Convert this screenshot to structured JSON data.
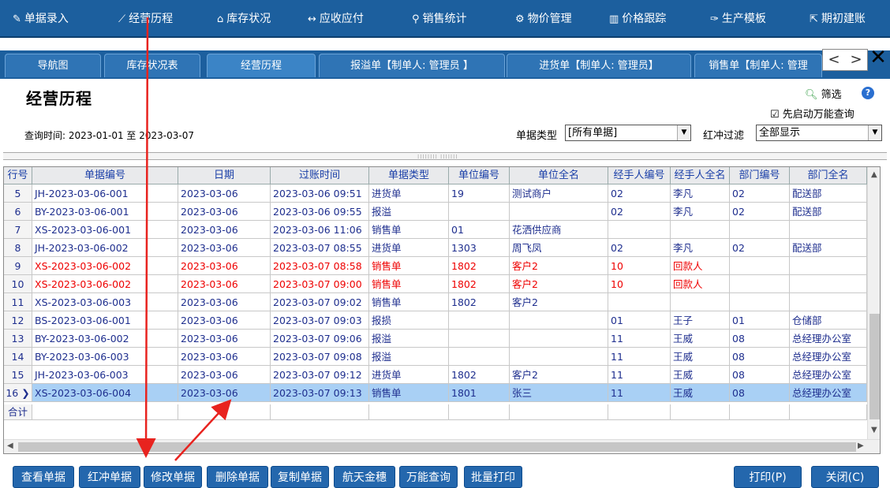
{
  "menu": [
    {
      "label": "单据录入",
      "icon": "edit-icon",
      "glyph": "✎"
    },
    {
      "label": "经营历程",
      "icon": "trend-icon",
      "glyph": "⟋"
    },
    {
      "label": "库存状况",
      "icon": "home-icon",
      "glyph": "⌂"
    },
    {
      "label": "应收应付",
      "icon": "exchange-icon",
      "glyph": "↔"
    },
    {
      "label": "销售统计",
      "icon": "search-icon",
      "glyph": "⚲"
    },
    {
      "label": "物价管理",
      "icon": "gear-icon",
      "glyph": "⚙"
    },
    {
      "label": "价格跟踪",
      "icon": "bar-chart-icon",
      "glyph": "▥"
    },
    {
      "label": "生产模板",
      "icon": "wrench-icon",
      "glyph": "✑"
    },
    {
      "label": "期初建账",
      "icon": "external-icon",
      "glyph": "⇱"
    }
  ],
  "tabs": [
    {
      "label": "导航图"
    },
    {
      "label": "库存状况表"
    },
    {
      "label": "经营历程"
    },
    {
      "label": "报溢单【制单人: 管理员 】"
    },
    {
      "label": "进货单【制单人: 管理员】"
    },
    {
      "label": "销售单【制单人: 管理"
    }
  ],
  "tabnav": {
    "prev": "<",
    "next": ">",
    "close": "✕"
  },
  "page": {
    "title": "经营历程",
    "filter_label": "筛选",
    "help_label": "?",
    "magic_query_check": "☑",
    "magic_query_label": "先启动万能查询",
    "query_time": "查询时间: 2023-01-01 至 2023-03-07",
    "doc_type_label": "单据类型",
    "doc_type_value": "[所有单据]",
    "red_filter_label": "红冲过滤",
    "red_filter_value": "全部显示",
    "splitter_grip": "⁞⁞⁞⁞⁞⁞⁞⁞ ⁞⁞⁞⁞⁞⁞⁞"
  },
  "grid": {
    "headers": [
      "行号",
      "单据编号",
      "日期",
      "过账时间",
      "单据类型",
      "单位编号",
      "单位全名",
      "经手人编号",
      "经手人全名",
      "部门编号",
      "部门全名"
    ],
    "rows": [
      {
        "no": "5",
        "c": [
          "JH-2023-03-06-001",
          "2023-03-06",
          "2023-03-06 09:51",
          "进货单",
          "19",
          "测试商户",
          "02",
          "李凡",
          "02",
          "配送部"
        ],
        "red": false,
        "sel": false
      },
      {
        "no": "6",
        "c": [
          "BY-2023-03-06-001",
          "2023-03-06",
          "2023-03-06 09:55",
          "报溢",
          "",
          "",
          "02",
          "李凡",
          "02",
          "配送部"
        ],
        "red": false,
        "sel": false
      },
      {
        "no": "7",
        "c": [
          "XS-2023-03-06-001",
          "2023-03-06",
          "2023-03-06 11:06",
          "销售单",
          "01",
          "花洒供应商",
          "",
          "",
          "",
          ""
        ],
        "red": false,
        "sel": false
      },
      {
        "no": "8",
        "c": [
          "JH-2023-03-06-002",
          "2023-03-06",
          "2023-03-07 08:55",
          "进货单",
          "1303",
          "周飞凤",
          "02",
          "李凡",
          "02",
          "配送部"
        ],
        "red": false,
        "sel": false
      },
      {
        "no": "9",
        "c": [
          "XS-2023-03-06-002",
          "2023-03-06",
          "2023-03-07 08:58",
          "销售单",
          "1802",
          "客户2",
          "10",
          "回款人",
          "",
          ""
        ],
        "red": true,
        "sel": false
      },
      {
        "no": "10",
        "c": [
          "XS-2023-03-06-002",
          "2023-03-06",
          "2023-03-07 09:00",
          "销售单",
          "1802",
          "客户2",
          "10",
          "回款人",
          "",
          ""
        ],
        "red": true,
        "sel": false
      },
      {
        "no": "11",
        "c": [
          "XS-2023-03-06-003",
          "2023-03-06",
          "2023-03-07 09:02",
          "销售单",
          "1802",
          "客户2",
          "",
          "",
          "",
          ""
        ],
        "red": false,
        "sel": false
      },
      {
        "no": "12",
        "c": [
          "BS-2023-03-06-001",
          "2023-03-06",
          "2023-03-07 09:03",
          "报损",
          "",
          "",
          "01",
          "王子",
          "01",
          "仓储部"
        ],
        "red": false,
        "sel": false
      },
      {
        "no": "13",
        "c": [
          "BY-2023-03-06-002",
          "2023-03-06",
          "2023-03-07 09:06",
          "报溢",
          "",
          "",
          "11",
          "王威",
          "08",
          "总经理办公室"
        ],
        "red": false,
        "sel": false
      },
      {
        "no": "14",
        "c": [
          "BY-2023-03-06-003",
          "2023-03-06",
          "2023-03-07 09:08",
          "报溢",
          "",
          "",
          "11",
          "王威",
          "08",
          "总经理办公室"
        ],
        "red": false,
        "sel": false
      },
      {
        "no": "15",
        "c": [
          "JH-2023-03-06-003",
          "2023-03-06",
          "2023-03-07 09:12",
          "进货单",
          "1802",
          "客户2",
          "11",
          "王威",
          "08",
          "总经理办公室"
        ],
        "red": false,
        "sel": false
      },
      {
        "no": "16 ❯",
        "c": [
          "XS-2023-03-06-004",
          "2023-03-06",
          "2023-03-07 09:13",
          "销售单",
          "1801",
          "张三",
          "11",
          "王威",
          "08",
          "总经理办公室"
        ],
        "red": false,
        "sel": true
      }
    ],
    "total_label": "合计"
  },
  "buttons": [
    {
      "label": "查看单据",
      "name": "view-doc-button"
    },
    {
      "label": "红冲单据",
      "name": "reverse-doc-button"
    },
    {
      "label": "修改单据",
      "name": "edit-doc-button"
    },
    {
      "label": "删除单据",
      "name": "delete-doc-button"
    },
    {
      "label": "复制单据",
      "name": "copy-doc-button"
    },
    {
      "label": "航天金穗",
      "name": "aisino-button"
    },
    {
      "label": "万能查询",
      "name": "universal-query-button"
    },
    {
      "label": "批量打印",
      "name": "batch-print-button"
    }
  ],
  "right_buttons": {
    "print": "打印(P)",
    "close": "关闭(C)"
  },
  "colors": {
    "menu_bg": "#1c5f9e",
    "button_bg": "#2467ad",
    "selected_row": "#a9d0f5",
    "red_text": "#e00000",
    "annotation_arrow": "#e8231f"
  }
}
